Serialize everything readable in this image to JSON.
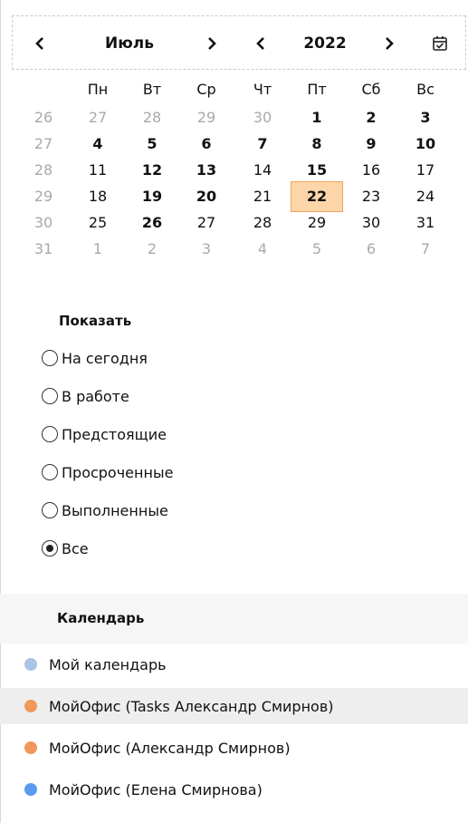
{
  "month_label": "Июль",
  "year_label": "2022",
  "weekdays": [
    "Пн",
    "Вт",
    "Ср",
    "Чт",
    "Пт",
    "Сб",
    "Вс"
  ],
  "weeks": [
    {
      "num": "26",
      "days": [
        {
          "d": "27",
          "m": true
        },
        {
          "d": "28",
          "m": true
        },
        {
          "d": "29",
          "m": true
        },
        {
          "d": "30",
          "m": true
        },
        {
          "d": "1",
          "b": true
        },
        {
          "d": "2",
          "b": true
        },
        {
          "d": "3",
          "b": true
        }
      ]
    },
    {
      "num": "27",
      "days": [
        {
          "d": "4",
          "b": true
        },
        {
          "d": "5",
          "b": true
        },
        {
          "d": "6",
          "b": true
        },
        {
          "d": "7",
          "b": true
        },
        {
          "d": "8",
          "b": true
        },
        {
          "d": "9",
          "b": true
        },
        {
          "d": "10",
          "b": true
        }
      ]
    },
    {
      "num": "28",
      "days": [
        {
          "d": "11"
        },
        {
          "d": "12",
          "b": true
        },
        {
          "d": "13",
          "b": true
        },
        {
          "d": "14"
        },
        {
          "d": "15",
          "b": true
        },
        {
          "d": "16"
        },
        {
          "d": "17"
        }
      ]
    },
    {
      "num": "29",
      "days": [
        {
          "d": "18"
        },
        {
          "d": "19",
          "b": true
        },
        {
          "d": "20",
          "b": true
        },
        {
          "d": "21"
        },
        {
          "d": "22",
          "b": true,
          "sel": true
        },
        {
          "d": "23"
        },
        {
          "d": "24"
        }
      ]
    },
    {
      "num": "30",
      "days": [
        {
          "d": "25"
        },
        {
          "d": "26",
          "b": true
        },
        {
          "d": "27"
        },
        {
          "d": "28"
        },
        {
          "d": "29"
        },
        {
          "d": "30"
        },
        {
          "d": "31"
        }
      ]
    },
    {
      "num": "31",
      "days": [
        {
          "d": "1",
          "m": true
        },
        {
          "d": "2",
          "m": true
        },
        {
          "d": "3",
          "m": true
        },
        {
          "d": "4",
          "m": true
        },
        {
          "d": "5",
          "m": true
        },
        {
          "d": "6",
          "m": true
        },
        {
          "d": "7",
          "m": true
        }
      ]
    }
  ],
  "show": {
    "title": "Показать",
    "options": [
      {
        "label": "На сегодня",
        "checked": false
      },
      {
        "label": "В работе",
        "checked": false
      },
      {
        "label": "Предстоящие",
        "checked": false
      },
      {
        "label": "Просроченные",
        "checked": false
      },
      {
        "label": "Выполненные",
        "checked": false
      },
      {
        "label": "Все",
        "checked": true
      }
    ]
  },
  "calendars": {
    "title": "Календарь",
    "items": [
      {
        "name": "Мой календарь",
        "color": "#a9c4e4"
      },
      {
        "name": "МойОфис (Tasks Александр Смирнов)",
        "color": "#f0975a",
        "hover": true
      },
      {
        "name": "МойОфис (Александр Смирнов)",
        "color": "#f0975a"
      },
      {
        "name": "МойОфис (Елена Смирнова)",
        "color": "#5b9bf0"
      }
    ]
  }
}
